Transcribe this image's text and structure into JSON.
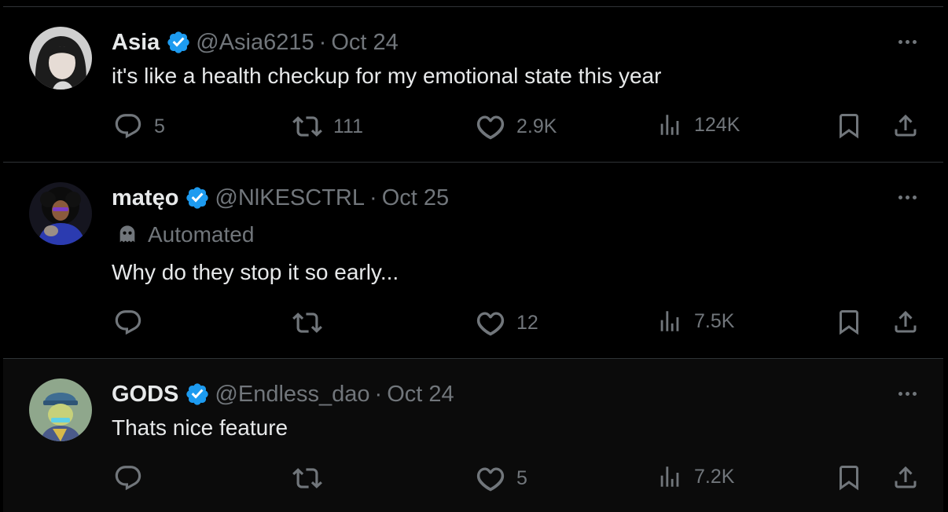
{
  "tweets": [
    {
      "name": "Asia",
      "handle": "@Asia6215",
      "separator": "·",
      "date": "Oct 24",
      "automated": "",
      "text": "it's like a health checkup for my emotional state this year",
      "replies": "5",
      "retweets": "111",
      "likes": "2.9K",
      "views": "124K"
    },
    {
      "name": "matęo",
      "handle": "@NlKESCTRL",
      "separator": "·",
      "date": "Oct 25",
      "automated": "Automated",
      "text": "Why do they stop it so early...",
      "replies": "",
      "retweets": "",
      "likes": "12",
      "views": "7.5K"
    },
    {
      "name": "GODS",
      "handle": "@Endless_dao",
      "separator": "·",
      "date": "Oct 24",
      "automated": "",
      "text": "Thats nice feature",
      "replies": "",
      "retweets": "",
      "likes": "5",
      "views": "7.2K"
    }
  ],
  "colors": {
    "background": "#000000",
    "text": "#e7e9ea",
    "muted": "#71767b",
    "verified": "#1d9bf0",
    "divider": "#2f3336"
  },
  "icons": [
    "verified-badge-icon",
    "more-icon",
    "reply-icon",
    "retweet-icon",
    "like-icon",
    "views-icon",
    "bookmark-icon",
    "share-icon",
    "bot-icon"
  ]
}
